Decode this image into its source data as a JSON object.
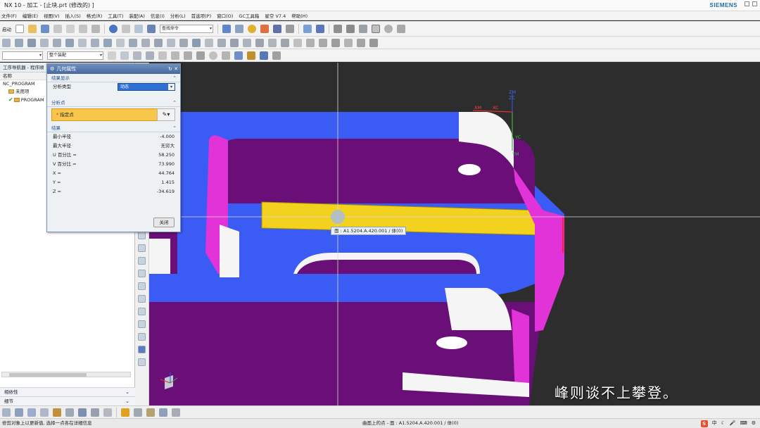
{
  "window": {
    "title": "NX 10 - 加工 - [止块.prt  (修改的)  ]",
    "brand": "SIEMENS"
  },
  "menu": [
    "文件(F)",
    "编辑(E)",
    "视图(V)",
    "插入(S)",
    "格式(R)",
    "工具(T)",
    "装配(A)",
    "信息(I)",
    "分析(L)",
    "首选项(P)",
    "窗口(O)",
    "GC工具箱",
    "星空 V7.4",
    "帮助(H)"
  ],
  "toolbar": {
    "start_label": "启动",
    "command_finder_placeholder": "查找命令",
    "selection_filter": "整个装配"
  },
  "navigator": {
    "title": "工序导航器 - 程序顺",
    "column_name": "名称",
    "items": [
      "NC_PROGRAM",
      "未用项",
      "PROGRAM"
    ],
    "sections": [
      "相依性",
      "细节"
    ]
  },
  "dialog": {
    "title": "几何属性",
    "section_display": "结果显示",
    "analysis_type_label": "分析类型",
    "analysis_type_value": "动态",
    "section_point": "分析点",
    "specify_point": "指定点",
    "section_results": "结果",
    "results": [
      {
        "label": "最小半径",
        "value": "-4.000"
      },
      {
        "label": "最大半径",
        "value": "无穷大"
      },
      {
        "label": "U 百分比 =",
        "value": "58.250"
      },
      {
        "label": "V 百分比 =",
        "value": "73.990"
      },
      {
        "label": "X =",
        "value": "44.764"
      },
      {
        "label": "Y =",
        "value": "1.415"
      },
      {
        "label": "Z =",
        "value": "-34.619"
      }
    ],
    "close_label": "关闭"
  },
  "viewport": {
    "tooltip": "面 : A1.5204.A.420.001 / 体(0)",
    "subtitle": "峰则谈不上攀登。",
    "axis_labels": {
      "xm": "XM",
      "xc": "XC",
      "zm": "ZM",
      "zc": "ZC",
      "yc": "YC",
      "ym": "YM"
    }
  },
  "status": {
    "left": "修剪对象上以更新值, 选择一点各在详细信息",
    "center": "曲面上的点 - 面 : A1.5204.A.420.001 / 体(0)"
  },
  "tray": {
    "ime": "S",
    "lang": "中"
  },
  "colors": {
    "part_blue": "#3b5bf5",
    "part_purple": "#6a0f78",
    "part_magenta": "#e233d8",
    "highlight_yellow": "#f2d21e",
    "background": "#2d2d2d"
  }
}
